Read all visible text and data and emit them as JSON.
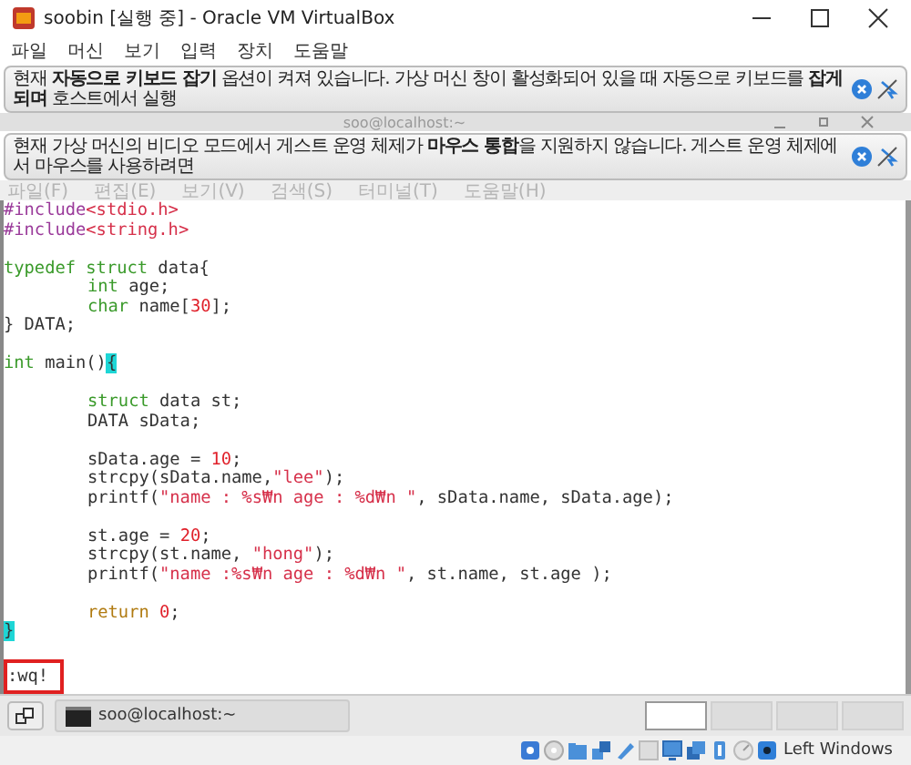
{
  "window": {
    "title": "soobin [실행 중] - Oracle VM VirtualBox"
  },
  "menu": [
    "파일",
    "머신",
    "보기",
    "입력",
    "장치",
    "도움말"
  ],
  "notices": [
    {
      "text": "현재 **자동으로 키보드 잡기** 옵션이 켜져 있습니다. 가상 머신 창이 활성화되어 있을 때 자동으로 키보드를 **잡게 되며** 호스트에서 실행"
    },
    {
      "text": "현재 가상 머신의 비디오 모드에서 게스트 운영 체제가 **마우스 통합**을 지원하지 않습니다. 게스트 운영 체제에서 마우스를 사용하려면"
    }
  ],
  "terminal": {
    "title": "soo@localhost:~",
    "menu": [
      "파일(F)",
      "편집(E)",
      "보기(V)",
      "검색(S)",
      "터미널(T)",
      "도움말(H)"
    ],
    "lines": [
      {
        "indent": false,
        "gap_before": false,
        "segments": [
          {
            "kind": "preproc",
            "text": "#include"
          },
          {
            "kind": "string",
            "text": "<stdio.h>"
          }
        ]
      },
      {
        "indent": false,
        "gap_before": false,
        "segments": [
          {
            "kind": "preproc",
            "text": "#include"
          },
          {
            "kind": "string",
            "text": "<string.h>"
          }
        ]
      },
      {
        "indent": false,
        "gap_before": true,
        "segments": [
          {
            "kind": "type",
            "text": "typedef struct"
          },
          {
            "kind": "plain",
            "text": " data{"
          }
        ]
      },
      {
        "indent": true,
        "gap_before": false,
        "segments": [
          {
            "kind": "type",
            "text": "int"
          },
          {
            "kind": "plain",
            "text": " age;"
          }
        ]
      },
      {
        "indent": true,
        "gap_before": false,
        "segments": [
          {
            "kind": "type",
            "text": "char"
          },
          {
            "kind": "plain",
            "text": " name["
          },
          {
            "kind": "number",
            "text": "30"
          },
          {
            "kind": "plain",
            "text": "];"
          }
        ]
      },
      {
        "indent": false,
        "gap_before": false,
        "segments": [
          {
            "kind": "plain",
            "text": "} DATA;"
          }
        ]
      },
      {
        "indent": false,
        "gap_before": true,
        "segments": [
          {
            "kind": "type",
            "text": "int"
          },
          {
            "kind": "plain",
            "text": " main()"
          },
          {
            "kind": "cursor",
            "text": "{"
          }
        ]
      },
      {
        "indent": true,
        "gap_before": true,
        "segments": [
          {
            "kind": "type",
            "text": "struct"
          },
          {
            "kind": "plain",
            "text": " data st;"
          }
        ]
      },
      {
        "indent": true,
        "gap_before": false,
        "segments": [
          {
            "kind": "plain",
            "text": "DATA sData;"
          }
        ]
      },
      {
        "indent": true,
        "gap_before": true,
        "segments": [
          {
            "kind": "plain",
            "text": "sData.age = "
          },
          {
            "kind": "number",
            "text": "10"
          },
          {
            "kind": "plain",
            "text": ";"
          }
        ]
      },
      {
        "indent": true,
        "gap_before": false,
        "segments": [
          {
            "kind": "plain",
            "text": "strcpy(sData.name,"
          },
          {
            "kind": "string",
            "text": "\"lee\""
          },
          {
            "kind": "plain",
            "text": ");"
          }
        ]
      },
      {
        "indent": true,
        "gap_before": false,
        "segments": [
          {
            "kind": "plain",
            "text": "printf("
          },
          {
            "kind": "string",
            "text": "\"name : %s₩n age : %d₩n \""
          },
          {
            "kind": "plain",
            "text": ", sData.name, sData.age);"
          }
        ]
      },
      {
        "indent": true,
        "gap_before": true,
        "segments": [
          {
            "kind": "plain",
            "text": "st.age = "
          },
          {
            "kind": "number",
            "text": "20"
          },
          {
            "kind": "plain",
            "text": ";"
          }
        ]
      },
      {
        "indent": true,
        "gap_before": false,
        "segments": [
          {
            "kind": "plain",
            "text": "strcpy(st.name, "
          },
          {
            "kind": "string",
            "text": "\"hong\""
          },
          {
            "kind": "plain",
            "text": ");"
          }
        ]
      },
      {
        "indent": true,
        "gap_before": false,
        "segments": [
          {
            "kind": "plain",
            "text": "printf("
          },
          {
            "kind": "string",
            "text": "\"name :%s₩n age : %d₩n \""
          },
          {
            "kind": "plain",
            "text": ", st.name, st.age );"
          }
        ]
      },
      {
        "indent": true,
        "gap_before": true,
        "segments": [
          {
            "kind": "keyword",
            "text": "return "
          },
          {
            "kind": "number",
            "text": "0"
          },
          {
            "kind": "plain",
            "text": ";"
          }
        ]
      },
      {
        "indent": false,
        "gap_before": false,
        "segments": [
          {
            "kind": "cursor",
            "text": "}"
          }
        ]
      }
    ],
    "command_line": {
      "text": ":wq!",
      "outlined": true
    }
  },
  "taskbar": {
    "tasks": [
      {
        "label": "soo@localhost:~",
        "selected": false
      }
    ],
    "workspaces": [
      {
        "selected": true
      },
      {
        "selected": false
      },
      {
        "selected": false
      },
      {
        "selected": false
      }
    ]
  },
  "status_bar": {
    "host_key": "Left Windows"
  }
}
